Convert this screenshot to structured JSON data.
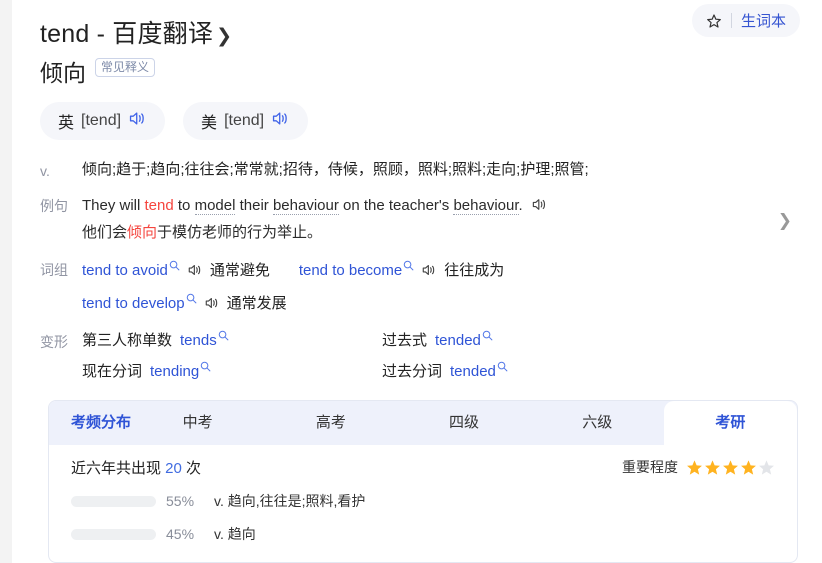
{
  "header": {
    "title": "tend - 百度翻译",
    "chevron": "❯",
    "vocab_button": {
      "icon": "star-icon",
      "label": "生词本"
    }
  },
  "meaning": {
    "text": "倾向",
    "badge": "常见释义"
  },
  "pronunciations": [
    {
      "lang": "英",
      "phonetic": "[tend]",
      "icon": "speaker-icon"
    },
    {
      "lang": "美",
      "phonetic": "[tend]",
      "icon": "speaker-icon"
    }
  ],
  "sections": {
    "pos": {
      "label": "v.",
      "definition": "倾向;趋于;趋向;往往会;常常就;招待，侍候，照顾，照料;照料;走向;护理;照管;"
    },
    "example": {
      "label": "例句",
      "en_parts": {
        "p1": "They will ",
        "kw": "tend",
        "p2": " to ",
        "u1": "model",
        "p3": " their ",
        "u2": "behaviour",
        "p4": " on the teacher's ",
        "u3": "behaviour",
        "p5": "."
      },
      "zh_parts": {
        "p1": "他们会",
        "kw": "倾向",
        "p2": "于模仿老师的行为举止。"
      },
      "speaker": "speaker-icon",
      "more": "❯"
    },
    "phrases": {
      "label": "词组",
      "items": [
        {
          "en": "tend to avoid",
          "zh": "通常避免"
        },
        {
          "en": "tend to become",
          "zh": "往往成为"
        },
        {
          "en": "tend to develop",
          "zh": "通常发展"
        }
      ]
    },
    "forms": {
      "label": "变形",
      "items": [
        {
          "key": "第三人称单数",
          "value": "tends"
        },
        {
          "key": "过去式",
          "value": "tended"
        },
        {
          "key": "现在分词",
          "value": "tending"
        },
        {
          "key": "过去分词",
          "value": "tended"
        }
      ]
    }
  },
  "panel": {
    "tab_title": "考频分布",
    "tabs": [
      {
        "label": "中考",
        "active": false
      },
      {
        "label": "高考",
        "active": false
      },
      {
        "label": "四级",
        "active": false
      },
      {
        "label": "六级",
        "active": false
      },
      {
        "label": "考研",
        "active": true
      }
    ],
    "summary": {
      "prefix": "近六年共出现 ",
      "count": "20",
      "suffix": " 次"
    },
    "importance": {
      "label": "重要程度",
      "filled": 4,
      "total": 5
    },
    "bars": [
      {
        "pct_label": "55%",
        "pct": 55,
        "text": "v. 趋向,往往是;照料,看护"
      },
      {
        "pct_label": "45%",
        "pct": 45,
        "text": "v. 趋向"
      }
    ]
  },
  "colors": {
    "accent": "#2f54d6",
    "highlight": "#f5453e",
    "bar": "#4a6ef0",
    "star": "#ffb320"
  }
}
